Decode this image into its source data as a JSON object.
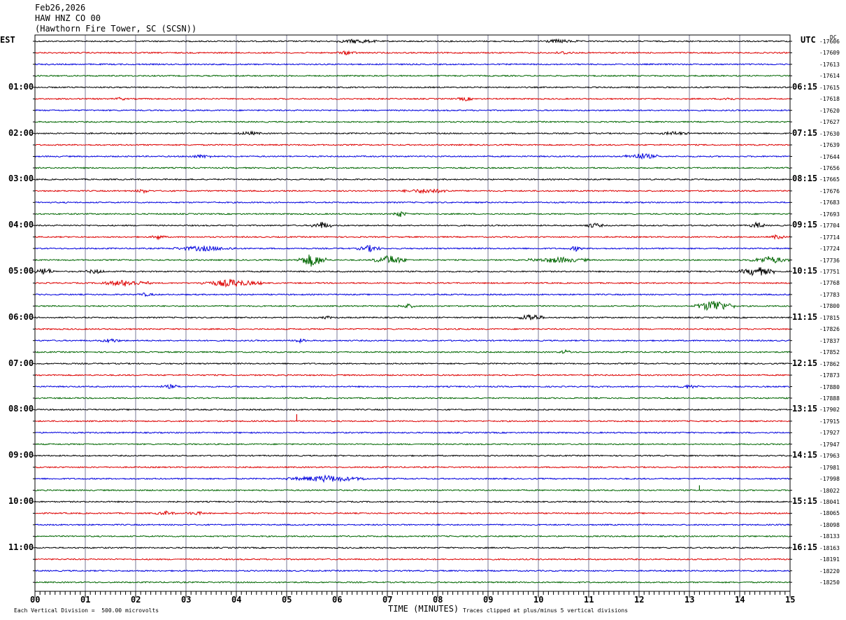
{
  "header": {
    "date": "Feb26,2026",
    "station": "HAW HNZ CO 00",
    "location": "(Hawthorn Fire Tower, SC (SCSN))"
  },
  "left_axis_label": "EST",
  "right_axis_label": "UTC",
  "dc_label": "DC",
  "footer": {
    "xlabel": "TIME (MINUTES)",
    "scale_note": "Each Vertical Division =  500.00 microvolts",
    "clip_note": "Traces clipped at plus/minus 5 vertical divisions"
  },
  "colors": {
    "trace_cycle": [
      "#000000",
      "#dd0000",
      "#0000dd",
      "#006600"
    ],
    "grid": "#7a7a96",
    "frame": "#000000"
  },
  "chart_data": {
    "type": "line",
    "title": "",
    "xlabel": "TIME (MINUTES)",
    "xlim": [
      0,
      15
    ],
    "x_ticks": [
      "00",
      "01",
      "02",
      "03",
      "04",
      "05",
      "06",
      "07",
      "08",
      "09",
      "10",
      "11",
      "12",
      "13",
      "14",
      "15"
    ],
    "rows_per_hour": 4,
    "left_hour_labels": [
      "01:00",
      "02:00",
      "03:00",
      "04:00",
      "05:00",
      "06:00",
      "07:00",
      "08:00",
      "09:00",
      "10:00",
      "11:00"
    ],
    "right_hour_labels": [
      "06:15",
      "07:15",
      "08:15",
      "09:15",
      "10:15",
      "11:15",
      "12:15",
      "13:15",
      "14:15",
      "15:15",
      "16:15"
    ],
    "dc_offsets": [
      "-17606",
      "-17609",
      "-17613",
      "-17614",
      "-17615",
      "-17618",
      "-17620",
      "-17627",
      "-17630",
      "-17639",
      "-17644",
      "-17656",
      "-17665",
      "-17676",
      "-17683",
      "-17693",
      "-17704",
      "-17714",
      "-17724",
      "-17736",
      "-17751",
      "-17768",
      "-17783",
      "-17800",
      "-17815",
      "-17826",
      "-17837",
      "-17852",
      "-17862",
      "-17873",
      "-17880",
      "-17888",
      "-17902",
      "-17915",
      "-17927",
      "-17947",
      "-17963",
      "-17981",
      "-17998",
      "-18022",
      "-18041",
      "-18065",
      "-18098",
      "-18133",
      "-18163",
      "-18191",
      "-18220",
      "-18250"
    ],
    "activity_bursts": [
      {
        "row": 0,
        "start": 6.0,
        "end": 6.8,
        "amp": 1.0
      },
      {
        "row": 0,
        "start": 10.0,
        "end": 10.8,
        "amp": 0.8
      },
      {
        "row": 1,
        "start": 6.0,
        "end": 6.4,
        "amp": 0.9
      },
      {
        "row": 1,
        "start": 10.3,
        "end": 10.7,
        "amp": 0.7
      },
      {
        "row": 5,
        "start": 1.6,
        "end": 1.8,
        "amp": 0.8
      },
      {
        "row": 5,
        "start": 8.4,
        "end": 8.7,
        "amp": 0.9
      },
      {
        "row": 5,
        "start": 13.6,
        "end": 13.9,
        "amp": 0.8
      },
      {
        "row": 8,
        "start": 4.0,
        "end": 4.5,
        "amp": 0.8
      },
      {
        "row": 8,
        "start": 12.4,
        "end": 13.0,
        "amp": 0.8
      },
      {
        "row": 10,
        "start": 11.7,
        "end": 12.4,
        "amp": 1.5
      },
      {
        "row": 10,
        "start": 3.0,
        "end": 3.6,
        "amp": 0.7
      },
      {
        "row": 13,
        "start": 7.3,
        "end": 8.3,
        "amp": 1.1
      },
      {
        "row": 13,
        "start": 2.0,
        "end": 2.3,
        "amp": 0.9
      },
      {
        "row": 15,
        "start": 7.1,
        "end": 7.4,
        "amp": 1.6
      },
      {
        "row": 16,
        "start": 5.5,
        "end": 5.9,
        "amp": 1.9
      },
      {
        "row": 16,
        "start": 10.9,
        "end": 11.3,
        "amp": 1.2
      },
      {
        "row": 16,
        "start": 14.2,
        "end": 14.5,
        "amp": 1.6
      },
      {
        "row": 17,
        "start": 2.3,
        "end": 2.6,
        "amp": 1.1
      },
      {
        "row": 17,
        "start": 14.6,
        "end": 14.9,
        "amp": 1.1
      },
      {
        "row": 18,
        "start": 2.7,
        "end": 4.0,
        "amp": 1.2
      },
      {
        "row": 18,
        "start": 6.4,
        "end": 6.9,
        "amp": 1.6
      },
      {
        "row": 18,
        "start": 10.6,
        "end": 10.9,
        "amp": 1.2
      },
      {
        "row": 19,
        "start": 5.2,
        "end": 5.8,
        "amp": 3.5
      },
      {
        "row": 19,
        "start": 6.7,
        "end": 7.4,
        "amp": 2.5
      },
      {
        "row": 19,
        "start": 9.8,
        "end": 11.0,
        "amp": 1.4
      },
      {
        "row": 19,
        "start": 14.2,
        "end": 15.0,
        "amp": 1.9
      },
      {
        "row": 20,
        "start": 0.0,
        "end": 0.4,
        "amp": 1.8
      },
      {
        "row": 20,
        "start": 1.0,
        "end": 1.4,
        "amp": 1.1
      },
      {
        "row": 20,
        "start": 14.0,
        "end": 14.7,
        "amp": 2.5
      },
      {
        "row": 21,
        "start": 1.3,
        "end": 2.3,
        "amp": 1.6
      },
      {
        "row": 21,
        "start": 3.3,
        "end": 4.5,
        "amp": 2.0
      },
      {
        "row": 22,
        "start": 2.0,
        "end": 2.4,
        "amp": 0.7
      },
      {
        "row": 23,
        "start": 13.1,
        "end": 13.9,
        "amp": 3.3
      },
      {
        "row": 23,
        "start": 7.2,
        "end": 7.6,
        "amp": 1.0
      },
      {
        "row": 24,
        "start": 9.6,
        "end": 10.1,
        "amp": 2.0
      },
      {
        "row": 24,
        "start": 5.7,
        "end": 5.9,
        "amp": 0.8
      },
      {
        "row": 26,
        "start": 1.3,
        "end": 1.7,
        "amp": 1.0
      },
      {
        "row": 26,
        "start": 5.1,
        "end": 5.4,
        "amp": 0.9
      },
      {
        "row": 27,
        "start": 10.4,
        "end": 10.7,
        "amp": 0.9
      },
      {
        "row": 30,
        "start": 2.5,
        "end": 2.9,
        "amp": 0.9
      },
      {
        "row": 30,
        "start": 12.8,
        "end": 13.2,
        "amp": 0.9
      },
      {
        "row": 38,
        "start": 5.0,
        "end": 6.6,
        "amp": 1.6
      },
      {
        "row": 41,
        "start": 2.4,
        "end": 2.8,
        "amp": 0.9
      },
      {
        "row": 41,
        "start": 3.0,
        "end": 3.4,
        "amp": 0.8
      }
    ],
    "spikes": [
      {
        "row": 33,
        "x": 5.2,
        "height": 10
      },
      {
        "row": 39,
        "x": 13.2,
        "height": 7
      }
    ]
  }
}
